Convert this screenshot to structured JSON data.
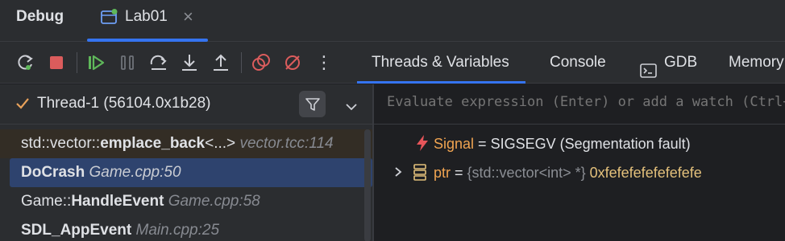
{
  "window": {
    "title": "Debug"
  },
  "session_tab": {
    "label": "Lab01",
    "close_glyph": "×",
    "icon": "debug-session-icon"
  },
  "toolbar": {
    "buttons": [
      "rerun-icon",
      "stop-icon",
      "resume-icon",
      "pause-icon",
      "step-over-icon",
      "step-into-icon",
      "step-out-icon",
      "view-breakpoints-icon",
      "mute-breakpoints-icon",
      "more-icon"
    ],
    "more_glyph": "⋮"
  },
  "view_tabs": [
    {
      "label": "Threads & Variables",
      "active": true
    },
    {
      "label": "Console",
      "active": false
    },
    {
      "label": "GDB",
      "active": false,
      "icon": "terminal-icon"
    },
    {
      "label": "Memory",
      "active": false
    }
  ],
  "thread": {
    "label": "Thread-1 (56104.0x1b28)",
    "status_icon": "check-icon"
  },
  "frames": [
    {
      "prefix": "std::vector::",
      "func": "emplace_back",
      "suffix": "<...>",
      "location": "vector.tcc:114",
      "library": true,
      "selected": false
    },
    {
      "prefix": "",
      "func": "DoCrash",
      "suffix": "",
      "location": "Game.cpp:50",
      "library": false,
      "selected": true
    },
    {
      "prefix": "Game::",
      "func": "HandleEvent",
      "suffix": "",
      "location": "Game.cpp:58",
      "library": false,
      "selected": false
    },
    {
      "prefix": "",
      "func": "SDL_AppEvent",
      "suffix": "",
      "location": "Main.cpp:25",
      "library": false,
      "selected": false
    }
  ],
  "evaluate": {
    "placeholder": "Evaluate expression (Enter) or add a watch (Ctrl+Shift+Enter)"
  },
  "variables": [
    {
      "name": "Signal",
      "eq": " = ",
      "value": "SIGSEGV (Segmentation fault)",
      "icon": "lightning-icon",
      "expandable": false
    },
    {
      "name": "ptr",
      "eq": " = ",
      "type": "{std::vector<int> *}",
      "value": "0xfefefefefefefefe",
      "icon": "variable-stack-icon",
      "expandable": true
    }
  ],
  "colors": {
    "accent": "#3574f0",
    "variable_name": "#f0a451",
    "pointer_value": "#e3c07b",
    "signal_icon": "#e8555a"
  }
}
